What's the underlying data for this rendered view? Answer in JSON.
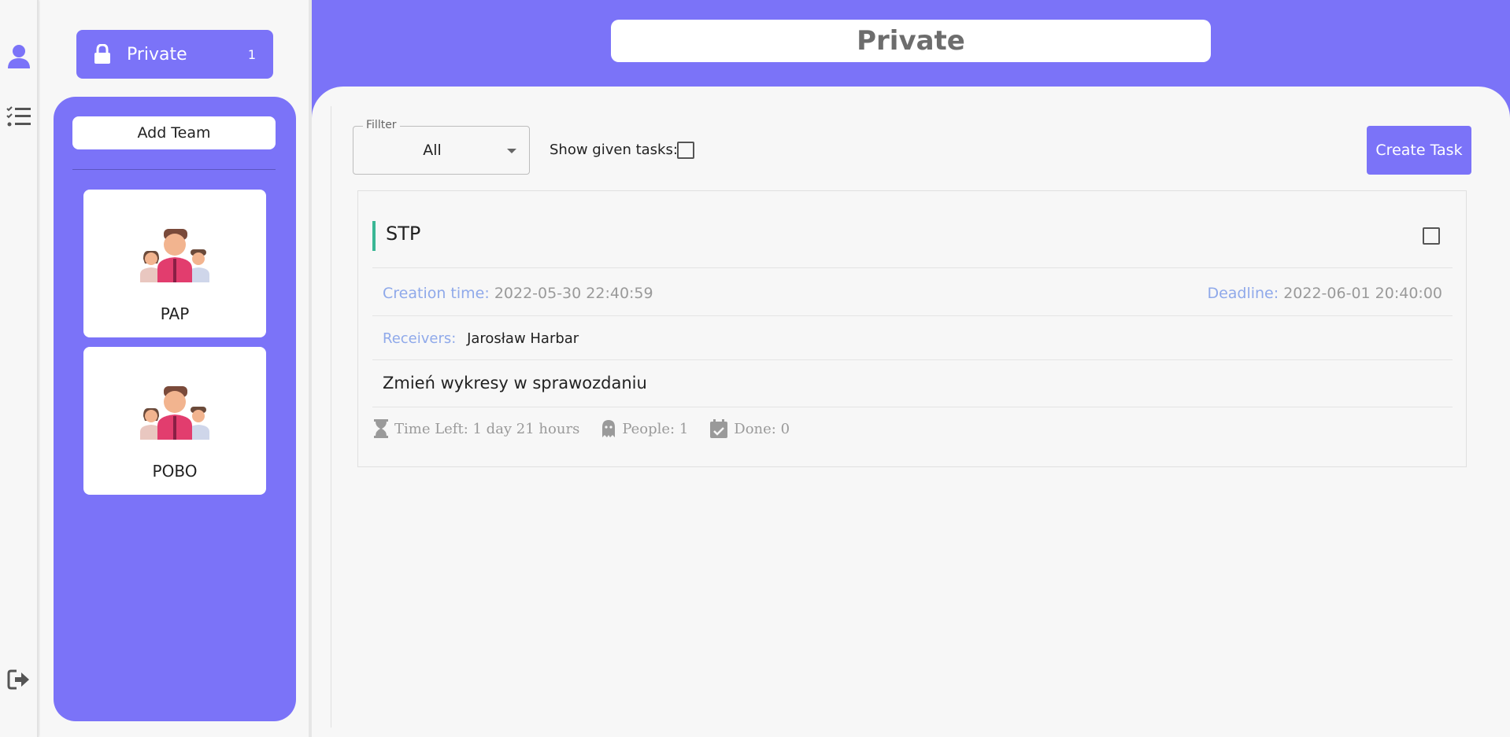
{
  "rail": {
    "icons": [
      "user-icon",
      "task-list-icon",
      "logout-icon"
    ]
  },
  "sidebar": {
    "private": {
      "label": "Private",
      "count": "1"
    },
    "add_team_label": "Add Team",
    "teams": [
      {
        "name": "PAP",
        "icon": "team-icon"
      },
      {
        "name": "POBO",
        "icon": "team-icon"
      }
    ]
  },
  "header": {
    "title": "Private"
  },
  "toolbar": {
    "filter_legend": "Fillter",
    "filter_value": "All",
    "show_given_label": "Show given tasks:",
    "show_given_checked": false,
    "create_task_label": "Create Task"
  },
  "task": {
    "title": "STP",
    "checked": false,
    "creation_label": "Creation time:",
    "creation_value": "2022-05-30 22:40:59",
    "deadline_label": "Deadline:",
    "deadline_value": "2022-06-01 20:40:00",
    "receivers_label": "Receivers:",
    "receivers_value": "Jarosław Harbar",
    "description": "Zmień wykresy w sprawozdaniu",
    "time_left": "Time Left: 1 day 21 hours",
    "people": "People: 1",
    "done": "Done: 0"
  },
  "colors": {
    "accent": "#7b73f8",
    "task_accent": "#3ab795",
    "meta_label": "#8fa9ea",
    "background": "#f7f7f7"
  }
}
